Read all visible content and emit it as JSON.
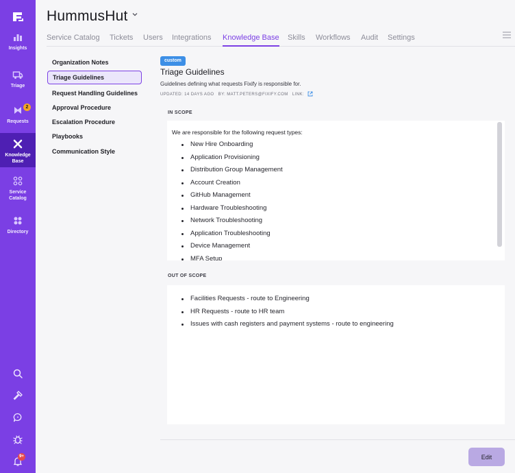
{
  "app": {
    "title": "HummusHut"
  },
  "rail": {
    "items": [
      {
        "label": "Insights",
        "icon": "bar-chart-icon"
      },
      {
        "label": "Triage",
        "icon": "truck-icon"
      },
      {
        "label": "Requests",
        "icon": "requests-icon",
        "badge": "2"
      },
      {
        "label": "Knowledge\nBase",
        "icon": "book-icon"
      },
      {
        "label": "Service\nCatalog",
        "icon": "catalog-icon"
      },
      {
        "label": "Directory",
        "icon": "directory-icon"
      }
    ],
    "notification_badge": "9+"
  },
  "tabs": [
    "Service Catalog",
    "Tickets",
    "Users",
    "Integrations",
    "Knowledge Base",
    "Skills",
    "Workflows",
    "Audit",
    "Settings"
  ],
  "active_tab": "Knowledge Base",
  "subnav": [
    "Organization Notes",
    "Triage Guidelines",
    "Request Handling Guidelines",
    "Approval Procedure",
    "Escalation Procedure",
    "Playbooks",
    "Communication Style"
  ],
  "active_subnav": "Triage Guidelines",
  "doc": {
    "tag": "custom",
    "title": "Triage Guidelines",
    "description": "Guidelines defining what requests Fixify is responsible for.",
    "meta_updated": "UPDATED: 14 DAYS AGO",
    "meta_by": "BY: MATT.PETERS@FIXIFY.COM",
    "meta_link": "LINK:"
  },
  "in_scope": {
    "label": "IN SCOPE",
    "intro": "We are responsible for the following request types:",
    "items": [
      "New Hire Onboarding",
      "Application Provisioning",
      "Distribution Group Management",
      "Account Creation",
      "GitHub Management",
      "Hardware Troubleshooting",
      "Network Troubleshooting",
      "Application Troubleshooting",
      "Device Management",
      "MFA Setup"
    ]
  },
  "out_of_scope": {
    "label": "OUT OF SCOPE",
    "items": [
      "Facilities Requests - route to Engineering",
      "HR Requests - route to HR team",
      "Issues with cash registers and payment systems - route to engineering"
    ]
  },
  "actions": {
    "edit_label": "Edit"
  },
  "colors": {
    "brand": "#7b3fe4",
    "brand_dark": "#4e1fb3",
    "tag": "#3d8fe6",
    "badge": "#f5a524",
    "alert": "#e5484d"
  }
}
